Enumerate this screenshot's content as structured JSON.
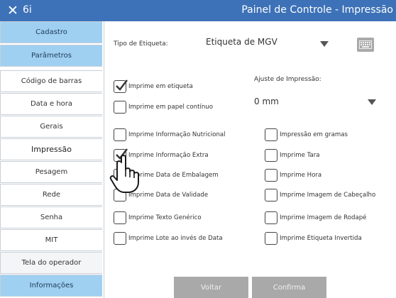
{
  "titlebar": {
    "close_glyph": "✕",
    "app_name": "6i",
    "title": "Painel de Controle - Impressão"
  },
  "sidebar": {
    "items": [
      {
        "label": "Cadastro",
        "style": "blue"
      },
      {
        "label": "Parâmetros",
        "style": "blue"
      },
      {
        "label": "Código de barras",
        "style": "white"
      },
      {
        "label": "Data e hora",
        "style": "white"
      },
      {
        "label": "Gerais",
        "style": "white"
      },
      {
        "label": "Impressão",
        "style": "active"
      },
      {
        "label": "Pesagem",
        "style": "white"
      },
      {
        "label": "Rede",
        "style": "white"
      },
      {
        "label": "Senha",
        "style": "white"
      },
      {
        "label": "MIT",
        "style": "white"
      },
      {
        "label": "Tela do operador",
        "style": "grey"
      },
      {
        "label": "Informações",
        "style": "blue"
      }
    ]
  },
  "main": {
    "label_type": {
      "label": "Tipo de Etiqueta:",
      "value": "Etiqueta de MGV"
    },
    "print_adjust": {
      "label": "Ajuste de Impressão:",
      "value": "0 mm"
    },
    "print_mode": [
      {
        "label": "Imprime em etiqueta",
        "checked": true
      },
      {
        "label": "Imprime em papel contínuo",
        "checked": false
      }
    ],
    "options_left": [
      {
        "label": "Imprime Informação Nutricional",
        "checked": false
      },
      {
        "label": "Imprime Informação Extra",
        "checked": true
      },
      {
        "label": "Imprime Data de Embalagem",
        "checked": false
      },
      {
        "label": "Imprime Data de Validade",
        "checked": false
      },
      {
        "label": "Imprime Texto Genérico",
        "checked": false
      },
      {
        "label": "Imprime Lote ao invés de Data",
        "checked": false
      }
    ],
    "options_right": [
      {
        "label": "Impressão em gramas",
        "checked": false
      },
      {
        "label": "Imprime Tara",
        "checked": false
      },
      {
        "label": "Imprime Hora",
        "checked": false
      },
      {
        "label": "Imprime Imagem de Cabeçalho",
        "checked": false
      },
      {
        "label": "Imprime Imagem de Rodapé",
        "checked": false
      },
      {
        "label": "Imprime Etiqueta Invertida",
        "checked": false
      }
    ],
    "buttons": {
      "back": "Voltar",
      "confirm": "Confirma"
    }
  },
  "colors": {
    "titlebar": "#3d72b8",
    "sidebar_blue": "#9fd0f2",
    "button_grey": "#a9a9a9"
  }
}
